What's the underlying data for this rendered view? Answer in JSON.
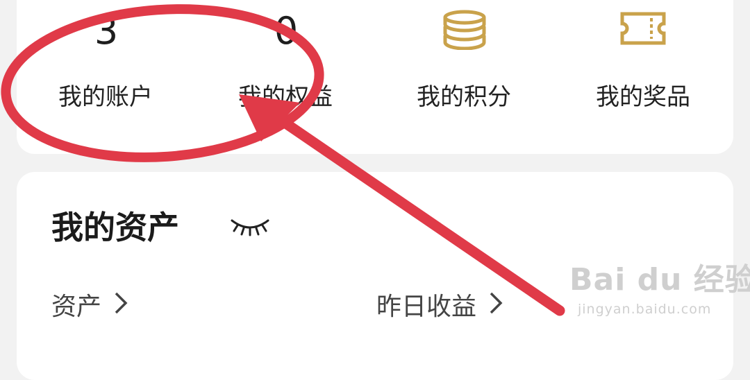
{
  "stats": {
    "account": {
      "count": "3",
      "label": "我的账户"
    },
    "equity": {
      "count": "0",
      "label": "我的权益"
    },
    "points": {
      "label": "我的积分",
      "icon": "coins-icon"
    },
    "prizes": {
      "label": "我的奖品",
      "icon": "ticket-icon"
    }
  },
  "assets": {
    "title": "我的资产",
    "visibility_icon": "closed-eye-icon",
    "asset_link": "资产",
    "yesterday_link": "昨日收益"
  },
  "watermark": {
    "main": "Bai du 经验",
    "sub": "jingyan.baidu.com"
  },
  "colors": {
    "gold": "#C9A24B",
    "annotation_red": "#E03A48",
    "card": "#FFFFFF",
    "background": "#F2F2F2"
  }
}
